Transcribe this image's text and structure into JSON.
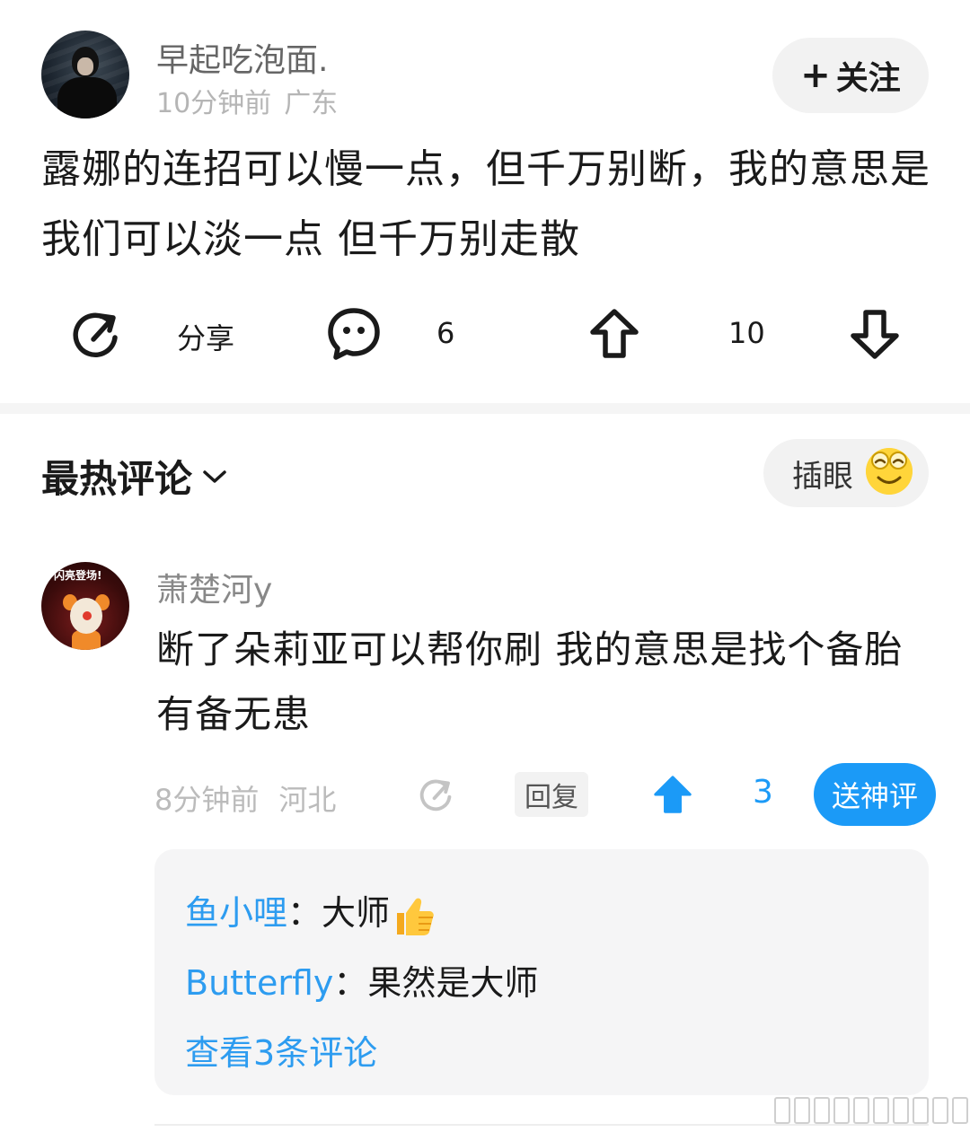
{
  "post": {
    "author": "早起吃泡面.",
    "time": "10分钟前",
    "location": "广东",
    "follow_label": "关注",
    "follow_plus": "+",
    "text": "露娜的连招可以慢一点，但千万别断，我的意思是我们可以淡一点 但千万别走散"
  },
  "actions": {
    "share_label": "分享",
    "comment_count": "6",
    "up_count": "10"
  },
  "comments_header": {
    "title": "最热评论",
    "insert_label": "插眼"
  },
  "comment": {
    "author": "萧楚河y",
    "avatar_tag": "闪亮登场!",
    "text": "断了朵莉亚可以帮你刷 我的意思是找个备胎有备无患",
    "time": "8分钟前",
    "location": "河北",
    "reply_label": "回复",
    "up_count": "3",
    "award_label": "送神评",
    "replies": [
      {
        "name": "鱼小哩",
        "colon": "：",
        "content": "大师",
        "emoji": "thumbs-up"
      },
      {
        "name": "Butterfly",
        "colon": "：",
        "content": "果然是大师"
      }
    ],
    "view_more": "查看3条评论"
  },
  "colors": {
    "accent_blue": "#1b9af7",
    "link_blue": "#2d9cf0",
    "emoji_yellow": "#ffd53a"
  }
}
